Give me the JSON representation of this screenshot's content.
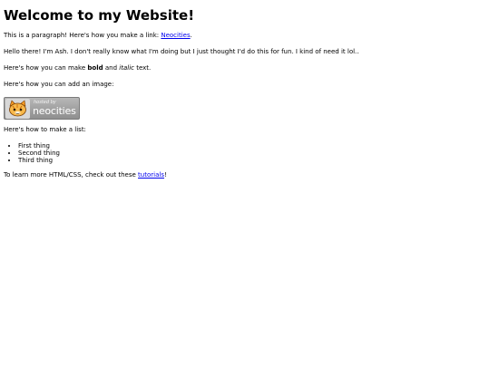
{
  "heading": "Welcome to my Website!",
  "paragraph1": {
    "before": "This is a paragraph! Here's how you make a link: ",
    "link_text": "Neocities",
    "after": "."
  },
  "paragraph2": "Hello there! I'm Ash. I don't really know what I'm doing but I just thought I'd do this for fun. I kind of need it lol..",
  "paragraph3": {
    "before": "Here's how you can make ",
    "bold": "bold",
    "middle": " and ",
    "italic": "italic",
    "after": " text."
  },
  "paragraph4": "Here's how you can add an image:",
  "badge": {
    "small_text": "hosted by",
    "name": "neocities"
  },
  "paragraph5": "Here's how to make a list:",
  "list": [
    "First thing",
    "Second thing",
    "Third thing"
  ],
  "paragraph6": {
    "before": "To learn more HTML/CSS, check out these ",
    "link_text": "tutorials",
    "after": "!"
  }
}
